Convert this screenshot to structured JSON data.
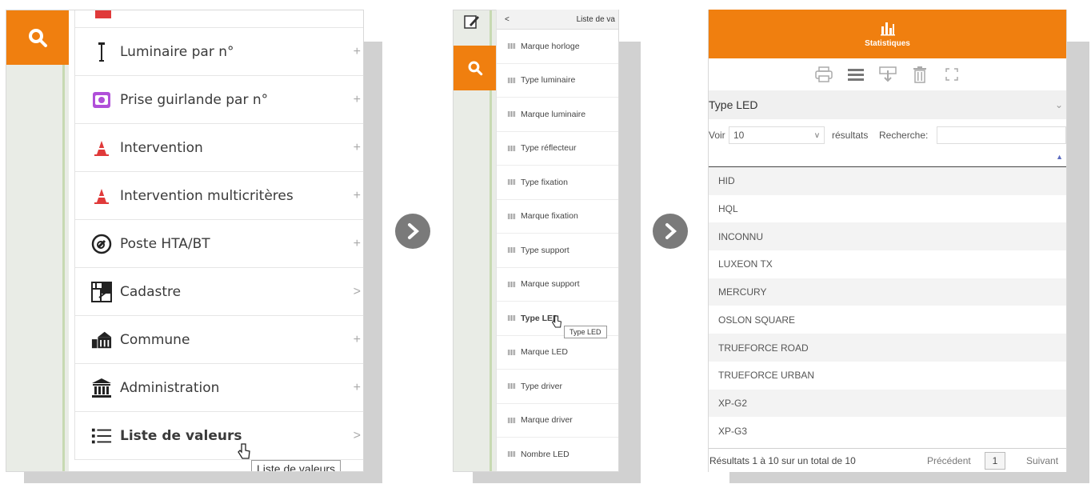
{
  "panel1": {
    "menu": [
      {
        "label": "Luminaire par n°",
        "icon": "lamp-post-icon",
        "suffix": "+"
      },
      {
        "label": "Prise guirlande par n°",
        "icon": "socket-icon",
        "suffix": "+"
      },
      {
        "label": "Intervention",
        "icon": "traffic-cone-icon",
        "suffix": "+"
      },
      {
        "label": "Intervention multicritères",
        "icon": "traffic-cone-icon",
        "suffix": "+"
      },
      {
        "label": "Poste HTA/BT",
        "icon": "no-plug-icon",
        "suffix": "+"
      },
      {
        "label": "Cadastre",
        "icon": "map-grid-icon",
        "suffix": ">"
      },
      {
        "label": "Commune",
        "icon": "town-hall-icon",
        "suffix": "+"
      },
      {
        "label": "Administration",
        "icon": "bank-icon",
        "suffix": "+"
      },
      {
        "label": "Liste de valeurs",
        "icon": "list-icon",
        "suffix": ">"
      }
    ],
    "tooltip": "Liste de valeurs"
  },
  "panel2": {
    "header": "Liste de va",
    "back": "<",
    "items": [
      "Marque horloge",
      "Type luminaire",
      "Marque luminaire",
      "Type réflecteur",
      "Type fixation",
      "Marque fixation",
      "Type support",
      "Marque support",
      "Type LED",
      "Marque LED",
      "Type driver",
      "Marque driver",
      "Nombre LED"
    ],
    "tooltip": "Type LED"
  },
  "panel3": {
    "header": "Statistiques",
    "title": "Type LED",
    "show_label": "Voir",
    "show_value": "10",
    "results_label": "résultats",
    "search_label": "Recherche:",
    "rows": [
      "HID",
      "HQL",
      "INCONNU",
      "LUXEON TX",
      "MERCURY",
      "OSLON SQUARE",
      "TRUEFORCE ROAD",
      "TRUEFORCE URBAN",
      "XP-G2",
      "XP-G3"
    ],
    "footer_info": "Résultats 1 à 10 sur un total de 10",
    "prev": "Précédent",
    "page": "1",
    "next": "Suivant"
  },
  "colors": {
    "accent": "#f07f0f",
    "arrow": "#7a7a7a"
  }
}
